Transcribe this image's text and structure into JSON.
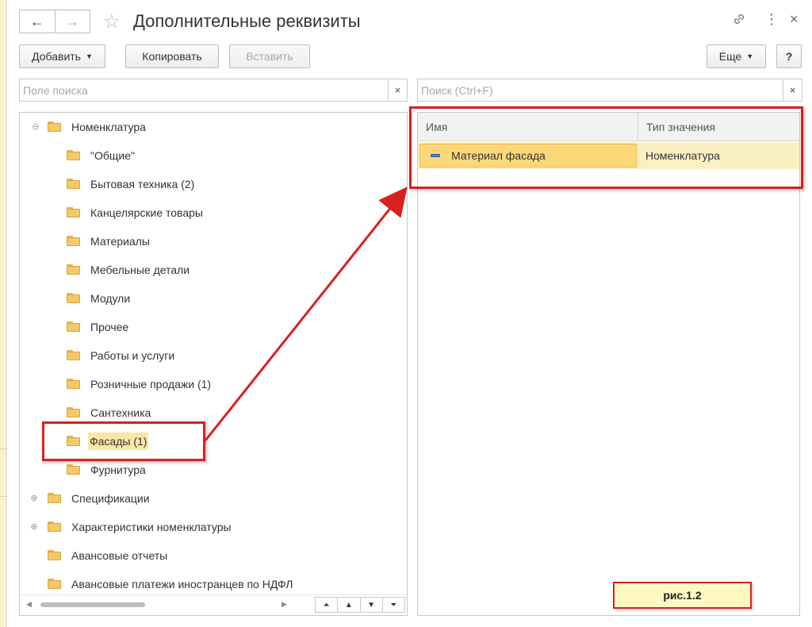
{
  "window": {
    "title": "Дополнительные реквизиты",
    "back_icon": "←",
    "forward_icon": "→",
    "star_icon": "☆",
    "link_icon": "🔗",
    "menu_icon": "⋮",
    "close_icon": "×"
  },
  "toolbar": {
    "add_label": "Добавить",
    "copy_label": "Копировать",
    "paste_label": "Вставить",
    "more_label": "Еще",
    "help_label": "?"
  },
  "left_search": {
    "placeholder": "Поле поиска",
    "clear": "×"
  },
  "right_search": {
    "placeholder": "Поиск (Ctrl+F)",
    "clear": "×"
  },
  "tree": {
    "root": {
      "label": "Номенклатура",
      "expander": "⊖"
    },
    "children": [
      "\"Общие\"",
      "Бытовая техника (2)",
      "Канцелярские товары",
      "Материалы",
      "Мебельные детали",
      "Модули",
      "Прочее",
      "Работы и услуги",
      "Розничные продажи (1)",
      "Сантехника",
      "Фасады (1)",
      "Фурнитура"
    ],
    "selected_child": "Фасады (1)",
    "top_level": [
      {
        "label": "Спецификации",
        "expander": "⊕"
      },
      {
        "label": "Характеристики номенклатуры",
        "expander": "⊕"
      },
      {
        "label": "Авансовые отчеты",
        "expander": ""
      },
      {
        "label": "Авансовые платежи иностранцев по НДФЛ",
        "expander": ""
      }
    ],
    "nav_buttons": [
      "⏶",
      "▲",
      "▼",
      "⏷"
    ]
  },
  "table": {
    "columns": [
      "Имя",
      "Тип значения"
    ],
    "rows": [
      {
        "name": "Материал фасада",
        "type": "Номенклатура"
      }
    ]
  },
  "figure_label": "рис.1.2",
  "colors": {
    "highlight": "#d82020",
    "selection": "#fbe7a4",
    "folder": "#f4c96a"
  }
}
